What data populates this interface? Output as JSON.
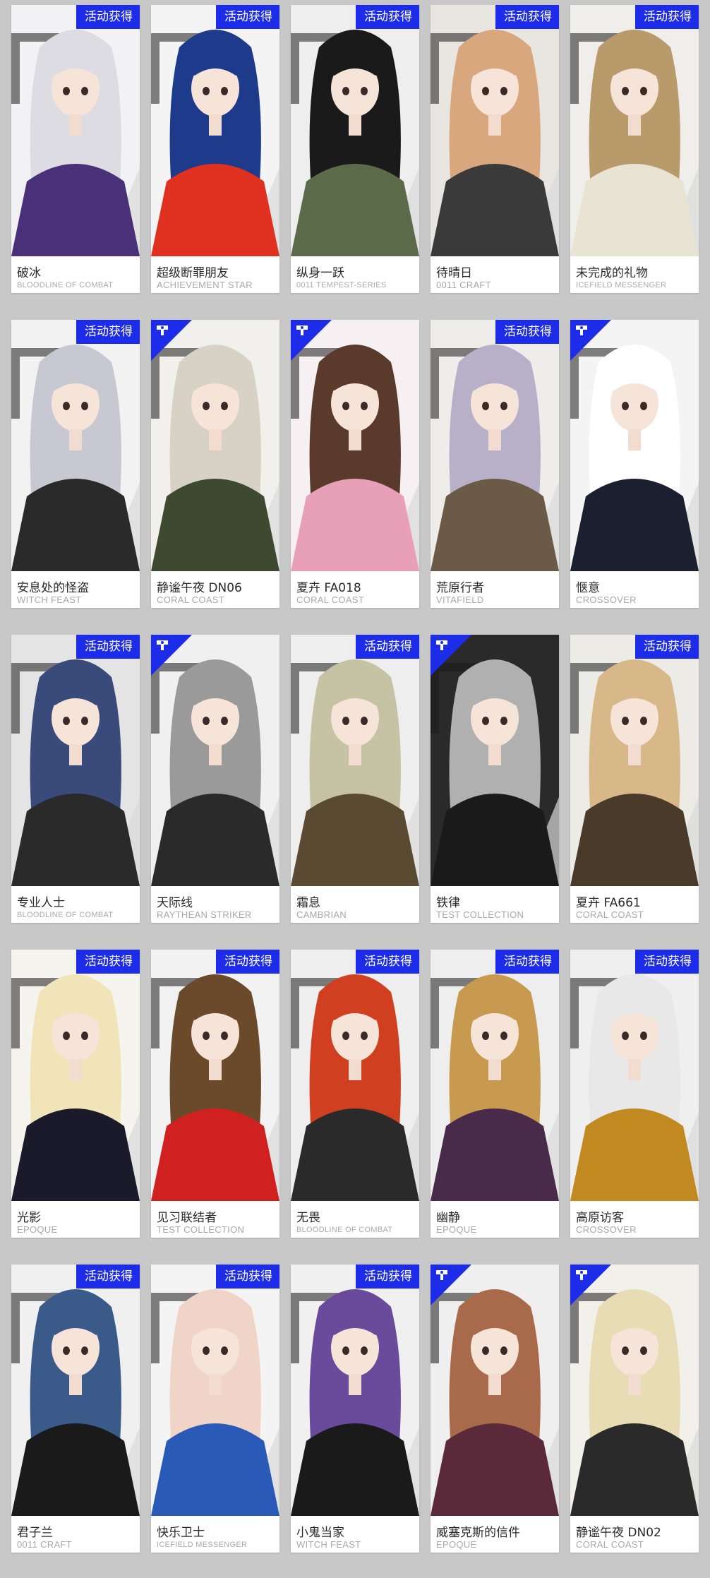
{
  "badge_label": "活动获得",
  "colors": {
    "badge_blue": "#1d2ce8",
    "background": "#c8c8c8",
    "card": "#ffffff",
    "skin_name_text": "#2a2a2a",
    "series_text": "#a9a9a9"
  },
  "skins": [
    {
      "name": "破冰",
      "series": "BLOODLINE OF COMBAT",
      "marker": "event-badge",
      "palette": [
        "#f2f2f4",
        "#4a3078",
        "#dcdce2"
      ]
    },
    {
      "name": "超级断罪朋友",
      "series": "ACHIEVEMENT STAR",
      "marker": "event-badge",
      "palette": [
        "#f4f4f4",
        "#e03020",
        "#1e3a8a"
      ]
    },
    {
      "name": "纵身一跃",
      "series": "0011 TEMPEST-SERIES",
      "marker": "event-badge",
      "palette": [
        "#eeeeee",
        "#5b6b4a",
        "#1a1a1a"
      ]
    },
    {
      "name": "待晴日",
      "series": "0011 CRAFT",
      "marker": "event-badge",
      "palette": [
        "#e9e6e2",
        "#3a3a3a",
        "#d9a77e"
      ]
    },
    {
      "name": "未完成的礼物",
      "series": "ICEFIELD MESSENGER",
      "marker": "event-badge",
      "palette": [
        "#efeeea",
        "#e8e3d2",
        "#b99a6a"
      ]
    },
    {
      "name": "安息处的怪盗",
      "series": "WITCH FEAST",
      "marker": "event-badge",
      "palette": [
        "#f2f2f2",
        "#2a2a2a",
        "#c8c8d2"
      ]
    },
    {
      "name": "静谧午夜 DN06",
      "series": "CORAL COAST",
      "marker": "series-emblem",
      "palette": [
        "#f1f0ec",
        "#3e4a30",
        "#d8d2c6"
      ]
    },
    {
      "name": "夏卉 FA018",
      "series": "CORAL COAST",
      "marker": "series-emblem",
      "palette": [
        "#f6f0f2",
        "#e8a0b8",
        "#5a3a2a"
      ]
    },
    {
      "name": "荒原行者",
      "series": "VITAFIELD",
      "marker": "event-badge",
      "palette": [
        "#efedea",
        "#6a5a46",
        "#b8b0c8"
      ]
    },
    {
      "name": "惬意",
      "series": "CROSSOVER",
      "marker": "series-emblem",
      "palette": [
        "#f4f4f4",
        "#1a2030",
        "#ffffff"
      ]
    },
    {
      "name": "专业人士",
      "series": "BLOODLINE OF COMBAT",
      "marker": "event-badge",
      "palette": [
        "#e4e4e4",
        "#2a2a2a",
        "#3a4a7a"
      ]
    },
    {
      "name": "天际线",
      "series": "RAYTHEAN STRIKER",
      "marker": "series-emblem",
      "palette": [
        "#f0f0f0",
        "#2a2a2a",
        "#9a9a9a"
      ]
    },
    {
      "name": "霜息",
      "series": "CAMBRIAN",
      "marker": "event-badge",
      "palette": [
        "#eeeeee",
        "#5a4a32",
        "#c6c2a4"
      ]
    },
    {
      "name": "铁律",
      "series": "TEST COLLECTION",
      "marker": "series-emblem",
      "palette": [
        "#2a2a2a",
        "#1a1a1a",
        "#b0b0b0"
      ]
    },
    {
      "name": "夏卉 FA661",
      "series": "CORAL COAST",
      "marker": "event-badge",
      "palette": [
        "#ecebe6",
        "#4a3a2a",
        "#d8b888"
      ]
    },
    {
      "name": "光影",
      "series": "EPOQUE",
      "marker": "event-badge",
      "palette": [
        "#f6f4ee",
        "#1a1a2a",
        "#f0e4b8"
      ]
    },
    {
      "name": "见习联结者",
      "series": "TEST COLLECTION",
      "marker": "event-badge",
      "palette": [
        "#f2f2f2",
        "#d02020",
        "#6a4a2a"
      ]
    },
    {
      "name": "无畏",
      "series": "BLOODLINE OF COMBAT",
      "marker": "event-badge",
      "palette": [
        "#eeeeee",
        "#2a2a2a",
        "#d04020"
      ]
    },
    {
      "name": "幽静",
      "series": "EPOQUE",
      "marker": "event-badge",
      "palette": [
        "#eeeeee",
        "#4a2a4a",
        "#c89a50"
      ]
    },
    {
      "name": "高原访客",
      "series": "CROSSOVER",
      "marker": "event-badge",
      "palette": [
        "#efefef",
        "#c08a20",
        "#e8e8e8"
      ]
    },
    {
      "name": "君子兰",
      "series": "0011 CRAFT",
      "marker": "event-badge",
      "palette": [
        "#f0f0f0",
        "#1a1a1a",
        "#3a5a8a"
      ]
    },
    {
      "name": "快乐卫士",
      "series": "ICEFIELD MESSENGER",
      "marker": "event-badge",
      "palette": [
        "#f4f4f4",
        "#2a5ab8",
        "#f0d4c8"
      ]
    },
    {
      "name": "小鬼当家",
      "series": "WITCH FEAST",
      "marker": "event-badge",
      "palette": [
        "#f0f0f0",
        "#1a1a1a",
        "#6a4a9a"
      ]
    },
    {
      "name": "威塞克斯的信件",
      "series": "EPOQUE",
      "marker": "series-emblem",
      "palette": [
        "#efefef",
        "#5a2a3a",
        "#a86a4a"
      ]
    },
    {
      "name": "静谧午夜 DN02",
      "series": "CORAL COAST",
      "marker": "series-emblem",
      "palette": [
        "#f2f0ea",
        "#2a2a2a",
        "#e8dcb4"
      ]
    }
  ]
}
